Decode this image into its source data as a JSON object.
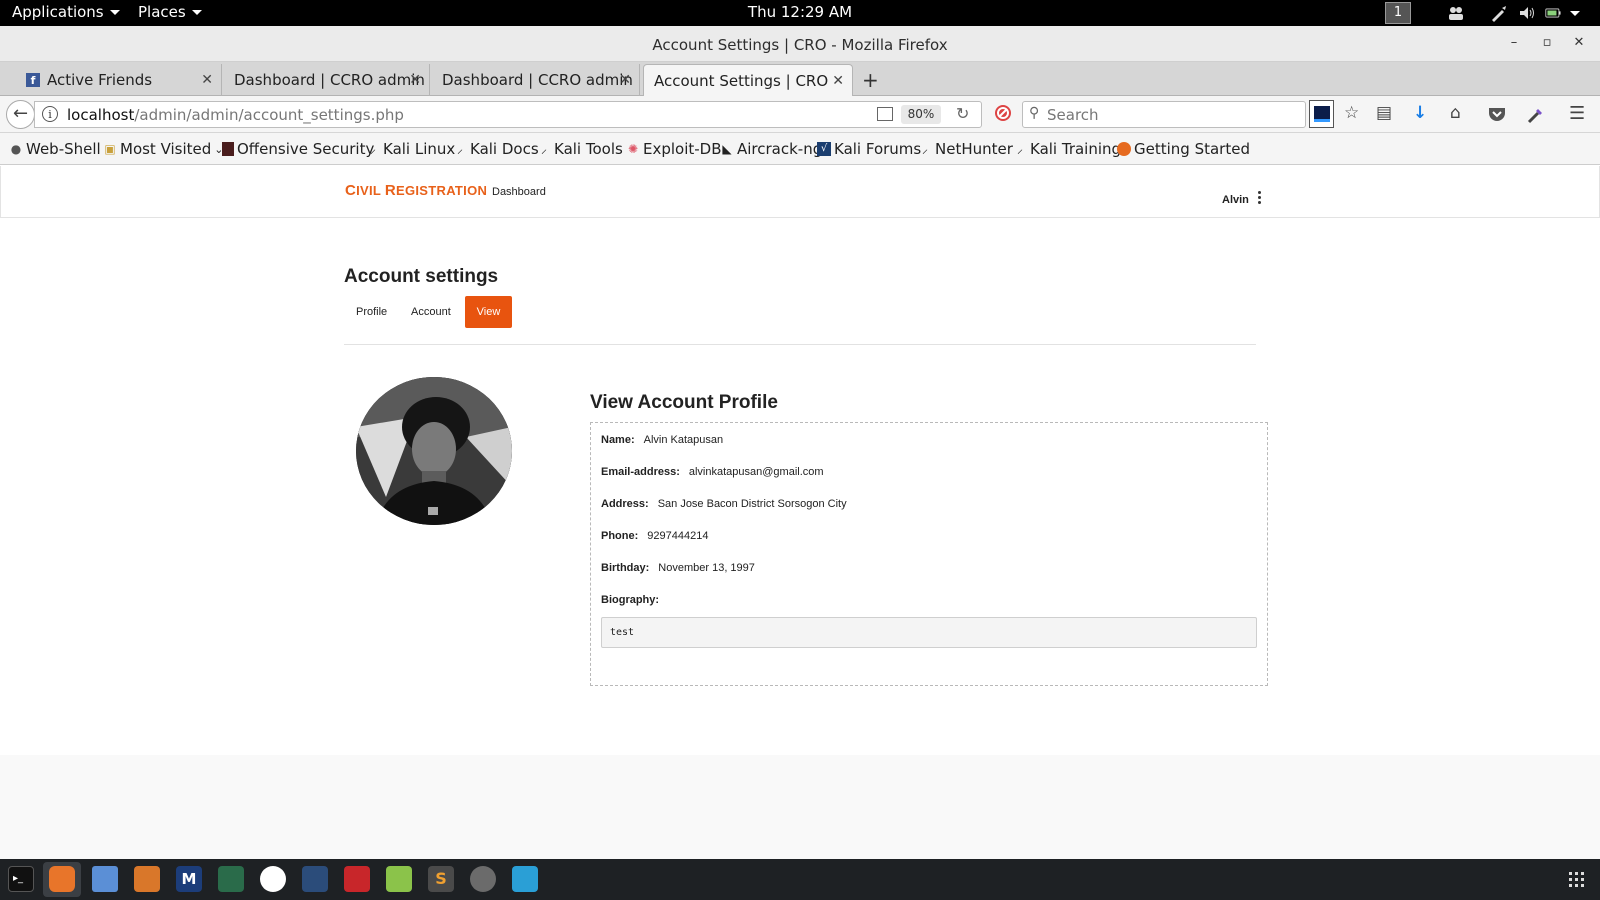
{
  "topbar": {
    "applications": "Applications",
    "places": "Places",
    "clock": "Thu 12:29 AM",
    "workspace": "1"
  },
  "window": {
    "title": "Account Settings | CRO - Mozilla Firefox"
  },
  "tabs": [
    {
      "label": "Active Friends",
      "icon": "facebook-icon"
    },
    {
      "label": "Dashboard | CCRO admin"
    },
    {
      "label": "Dashboard | CCRO admin"
    },
    {
      "label": "Account Settings | CRO",
      "active": true
    }
  ],
  "navbar": {
    "url_host": "localhost",
    "url_path": "/admin/admin/account_settings.php",
    "zoom": "80%",
    "search_placeholder": "Search"
  },
  "bookmarks": [
    {
      "label": "Web-Shell",
      "icon": "globe-icon"
    },
    {
      "label": "Most Visited",
      "icon": "folder-icon"
    },
    {
      "label": "Offensive Security",
      "icon": "offsec-icon"
    },
    {
      "label": "Kali Linux",
      "icon": "kali-icon"
    },
    {
      "label": "Kali Docs",
      "icon": "kali-icon"
    },
    {
      "label": "Kali Tools",
      "icon": "kali-icon"
    },
    {
      "label": "Exploit-DB",
      "icon": "exploit-db-icon"
    },
    {
      "label": "Aircrack-ng",
      "icon": "aircrack-icon"
    },
    {
      "label": "Kali Forums",
      "icon": "kali-forums-icon"
    },
    {
      "label": "NetHunter",
      "icon": "kali-icon"
    },
    {
      "label": "Kali Training",
      "icon": "kali-icon"
    },
    {
      "label": "Getting Started",
      "icon": "firefox-icon"
    }
  ],
  "site": {
    "brand_first": "C",
    "brand_rest": "IVIL ",
    "brand_second": "R",
    "brand_rest2": "EGISTRATION",
    "nav_dashboard": "Dashboard",
    "user": "Alvin"
  },
  "settings": {
    "title": "Account settings",
    "tabs": [
      "Profile",
      "Account",
      "View"
    ],
    "active_tab": "View"
  },
  "profile": {
    "title": "View Account Profile",
    "fields": [
      {
        "label": "Name:",
        "value": "Alvin Katapusan"
      },
      {
        "label": "Email-address:",
        "value": "alvinkatapusan@gmail.com"
      },
      {
        "label": "Address:",
        "value": "San Jose Bacon District Sorsogon City"
      },
      {
        "label": "Phone:",
        "value": "9297444214"
      },
      {
        "label": "Birthday:",
        "value": "November 13, 1997"
      }
    ],
    "bio_label": "Biography:",
    "bio_value": "test"
  },
  "colors": {
    "accent": "#e8540f",
    "brand": "#e8611a"
  }
}
